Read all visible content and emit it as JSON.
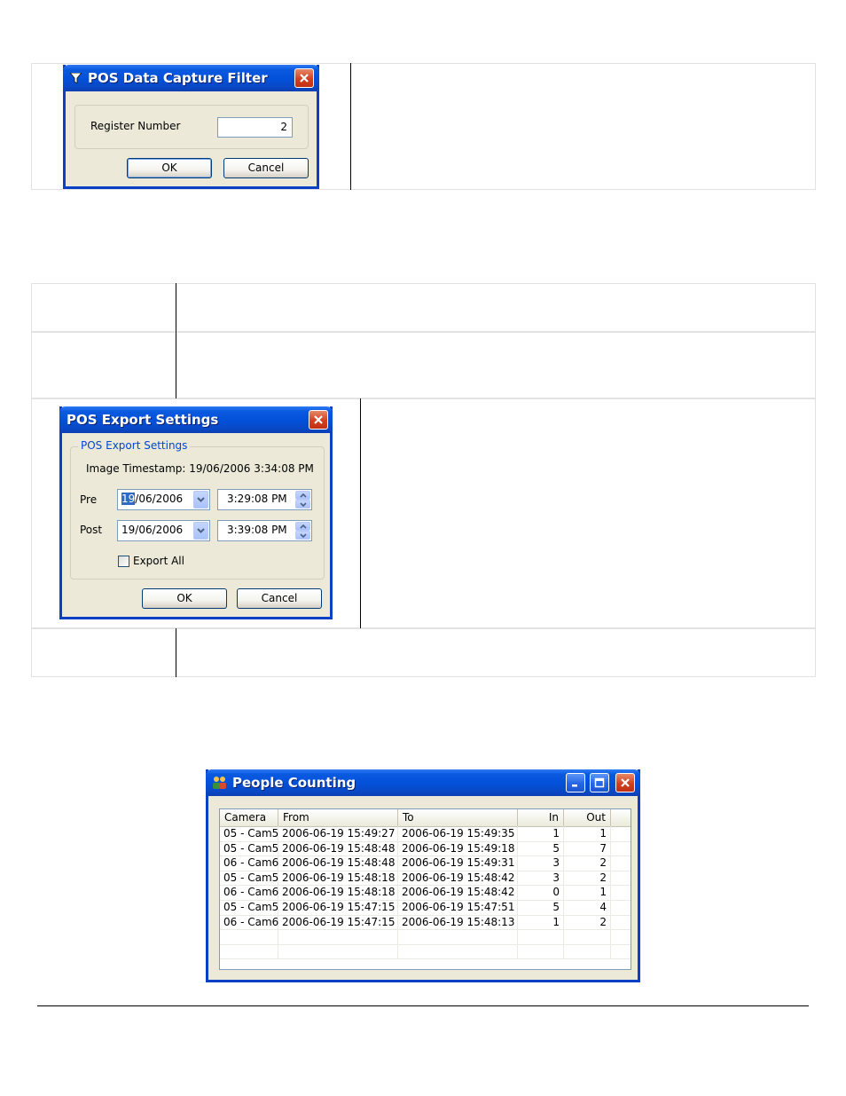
{
  "pos_capture_filter": {
    "title": "POS Data Capture Filter",
    "icon": "funnel-icon",
    "register_label": "Register Number",
    "register_value": "2",
    "ok": "OK",
    "cancel": "Cancel"
  },
  "pos_export_settings": {
    "title": "POS Export Settings",
    "group_label": "POS Export Settings",
    "timestamp": "Image Timestamp: 19/06/2006 3:34:08 PM",
    "pre_label": "Pre",
    "pre_date_selected": "19",
    "pre_date_rest": "/06/2006",
    "pre_time": "3:29:08 PM",
    "post_label": "Post",
    "post_date": "19/06/2006",
    "post_time": "3:39:08 PM",
    "export_all_label": "Export All",
    "export_all_checked": false,
    "ok": "OK",
    "cancel": "Cancel"
  },
  "people_counting": {
    "title": "People Counting",
    "icon": "people-icon",
    "columns": [
      "Camera",
      "From",
      "To",
      "In",
      "Out"
    ],
    "rows": [
      [
        "05 - Cam5",
        "2006-06-19 15:49:27",
        "2006-06-19 15:49:35",
        "1",
        "1"
      ],
      [
        "05 - Cam5",
        "2006-06-19 15:48:48",
        "2006-06-19 15:49:18",
        "5",
        "7"
      ],
      [
        "06 - Cam6",
        "2006-06-19 15:48:48",
        "2006-06-19 15:49:31",
        "3",
        "2"
      ],
      [
        "05 - Cam5",
        "2006-06-19 15:48:18",
        "2006-06-19 15:48:42",
        "3",
        "2"
      ],
      [
        "06 - Cam6",
        "2006-06-19 15:48:18",
        "2006-06-19 15:48:42",
        "0",
        "1"
      ],
      [
        "05 - Cam5",
        "2006-06-19 15:47:15",
        "2006-06-19 15:47:51",
        "5",
        "4"
      ],
      [
        "06 - Cam6",
        "2006-06-19 15:47:15",
        "2006-06-19 15:48:13",
        "1",
        "2"
      ]
    ]
  }
}
